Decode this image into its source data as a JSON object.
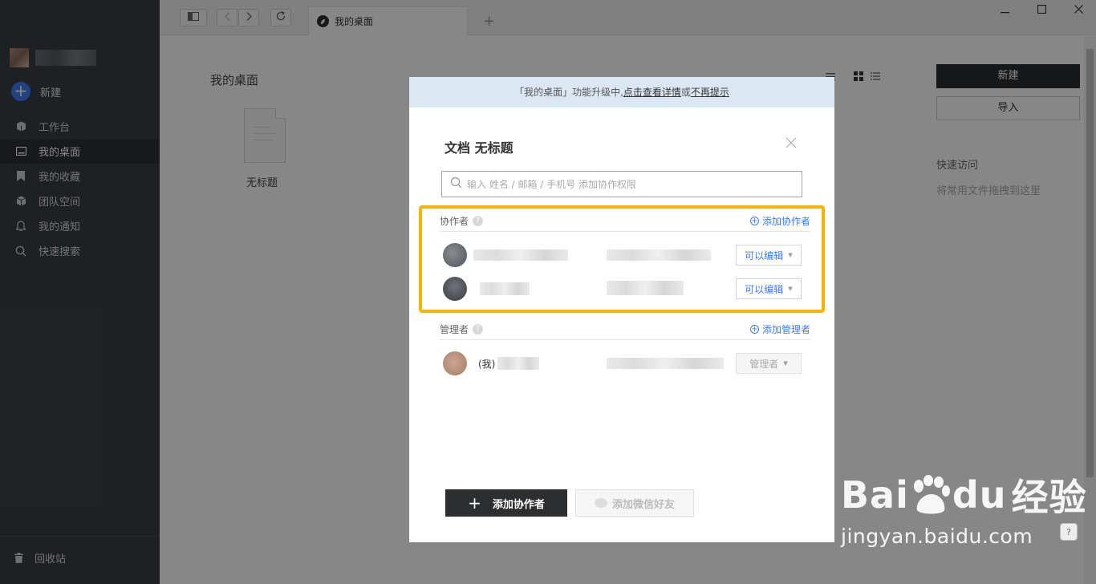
{
  "sidebar": {
    "new_label": "新建",
    "items": [
      {
        "label": "工作台",
        "icon": "workbench-icon",
        "active": false
      },
      {
        "label": "我的桌面",
        "icon": "desktop-icon",
        "active": true
      },
      {
        "label": "我的收藏",
        "icon": "bookmark-icon",
        "active": false
      },
      {
        "label": "团队空间",
        "icon": "team-cube-icon",
        "active": false
      },
      {
        "label": "我的通知",
        "icon": "bell-icon",
        "active": false
      },
      {
        "label": "快速搜索",
        "icon": "search-icon",
        "active": false
      }
    ],
    "trash_label": "回收站"
  },
  "browser": {
    "tab_title": "我的桌面",
    "new_tab": "+"
  },
  "main": {
    "page_title": "我的桌面",
    "file_name": "无标题",
    "new_button": "新建",
    "import_button": "导入",
    "quick_access_title": "快速访问",
    "quick_access_hint": "将常用文件拖拽到这里"
  },
  "dialog": {
    "notice_prefix": "「我的桌面」功能升级中,",
    "notice_link1": "点击查看详情",
    "notice_or": "或",
    "notice_link2": "不再提示",
    "title": "文档 无标题",
    "search_placeholder": "输入 姓名 / 邮箱 / 手机号 添加协作权限",
    "collaborators_label": "协作者",
    "add_collaborator_link": "添加协作者",
    "collaborators": [
      {
        "permission": "可以编辑"
      },
      {
        "permission": "可以编辑"
      }
    ],
    "managers_label": "管理者",
    "add_manager_link": "添加管理者",
    "manager": {
      "me_label": "(我)",
      "permission": "管理者"
    },
    "add_collaborator_button": "添加协作者",
    "add_wechat_button": "添加微信好友",
    "help_mark": "?"
  },
  "watermark": {
    "brand": "Bai",
    "brand_du": "du",
    "brand_cn": "经验",
    "url": "jingyan.baidu.com"
  },
  "colors": {
    "sidebar_bg": "#3b3e45",
    "accent_blue": "#3e7ff0",
    "highlight": "#f8b500",
    "dark_button": "#2d2e30"
  }
}
